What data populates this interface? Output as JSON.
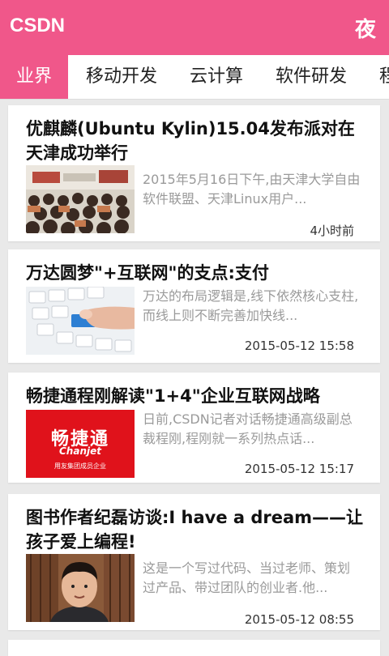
{
  "app": {
    "title": "CSDN",
    "night_mode_label": "夜",
    "accent_color": "#f0578a"
  },
  "tabs": [
    {
      "label": "业界",
      "active": true
    },
    {
      "label": "移动开发",
      "active": false
    },
    {
      "label": "云计算",
      "active": false
    },
    {
      "label": "软件研发",
      "active": false
    },
    {
      "label": "程",
      "active": false
    }
  ],
  "articles": [
    {
      "title": "优麒麟(Ubuntu Kylin)15.04发布派对在天津成功举行",
      "summary": "2015年5月16日下午,由天津大学自由软件联盟、天津Linux用户...",
      "time": "4小时前",
      "thumb": "conference-audience-photo"
    },
    {
      "title": "万达圆梦\"+互联网\"的支点:支付",
      "summary": "万达的布局逻辑是,线下依然核心支柱,而线上则不断完善加快线...",
      "time": "2015-05-12 15:58",
      "thumb": "keyboard-pay-key-photo"
    },
    {
      "title": "畅捷通程刚解读\"1+4\"企业互联网战略",
      "summary": "日前,CSDN记者对话畅捷通高级副总裁程刚,程刚就一系列热点话...",
      "time": "2015-05-12 15:17",
      "thumb": "chanjet-logo",
      "thumb_text": {
        "cn": "畅捷通",
        "en": "Chanjet",
        "sub": "用友集团成员企业"
      }
    },
    {
      "title": "图书作者纪磊访谈:I have a dream——让孩子爱上编程!",
      "summary": "这是一个写过代码、当过老师、策划过产品、带过团队的创业者.他...",
      "time": "2015-05-12 08:55",
      "thumb": "author-portrait-photo"
    }
  ]
}
